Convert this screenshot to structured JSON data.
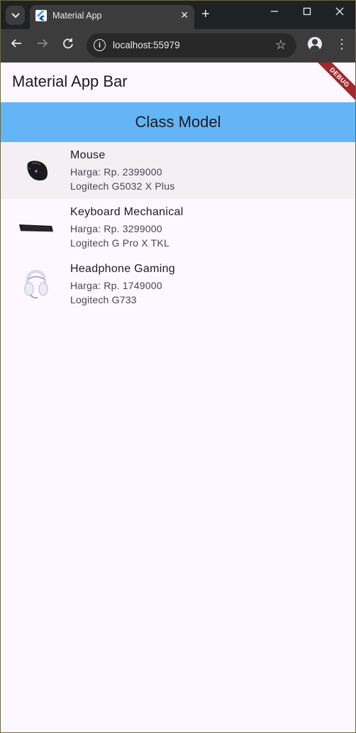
{
  "browser": {
    "tab_title": "Material App",
    "url": "localhost:55979",
    "new_tab_symbol": "+",
    "close_symbol": "✕"
  },
  "app": {
    "appbar_title": "Material App Bar",
    "debug_label": "DEBUG",
    "header_title": "Class Model",
    "header_color": "#64b5f6",
    "products": [
      {
        "name": "Mouse",
        "price": "Harga: Rp. 2399000",
        "desc": "Logitech G5032 X Plus",
        "icon": "mouse-image",
        "selected": true
      },
      {
        "name": "Keyboard Mechanical",
        "price": "Harga: Rp. 3299000",
        "desc": "Logitech G Pro X TKL",
        "icon": "keyboard-image",
        "selected": false
      },
      {
        "name": "Headphone Gaming",
        "price": "Harga: Rp. 1749000",
        "desc": "Logitech G733",
        "icon": "headphone-image",
        "selected": false
      }
    ]
  }
}
